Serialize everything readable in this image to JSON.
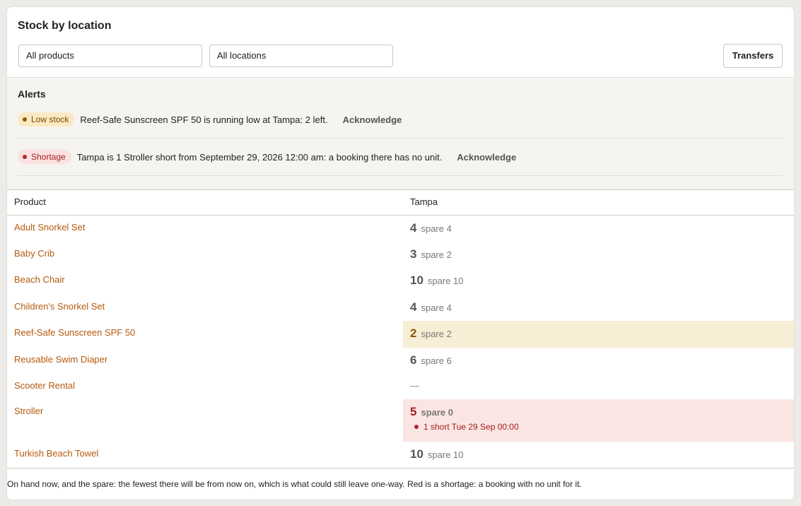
{
  "header": {
    "title": "Stock by location",
    "product_filter": "All products",
    "location_filter": "All locations",
    "transfers_label": "Transfers"
  },
  "alerts": {
    "title": "Alerts",
    "items": [
      {
        "badge": "Low stock",
        "text": "Reef-Safe Sunscreen SPF 50 is running low at Tampa: 2 left.",
        "action": "Acknowledge"
      },
      {
        "badge": "Shortage",
        "text": "Tampa is 1 Stroller short from September 29, 2026 12:00 am: a booking there has no unit.",
        "action": "Acknowledge"
      }
    ]
  },
  "table": {
    "headers": {
      "product": "Product",
      "location": "Tampa"
    },
    "rows": [
      {
        "product": "Adult Snorkel Set",
        "qty": "4",
        "spare": "spare 4"
      },
      {
        "product": "Baby Crib",
        "qty": "3",
        "spare": "spare 2"
      },
      {
        "product": "Beach Chair",
        "qty": "10",
        "spare": "spare 10"
      },
      {
        "product": "Children's Snorkel Set",
        "qty": "4",
        "spare": "spare 4"
      },
      {
        "product": "Reef-Safe Sunscreen SPF 50",
        "qty": "2",
        "spare": "spare 2",
        "status": "low"
      },
      {
        "product": "Reusable Swim Diaper",
        "qty": "6",
        "spare": "spare 6"
      },
      {
        "product": "Scooter Rental",
        "empty": "—"
      },
      {
        "product": "Stroller",
        "qty": "5",
        "spare": "spare 0",
        "status": "short",
        "note": "1 short Tue 29 Sep 00:00"
      },
      {
        "product": "Turkish Beach Towel",
        "qty": "10",
        "spare": "spare 10"
      }
    ]
  },
  "footnote": "On hand now, and the spare: the fewest there will be from now on, which is what could still leave one-way. Red is a shortage: a booking with no unit for it.",
  "colors": {
    "link": "#b5590d",
    "low_bg": "#f8edd5",
    "short_bg": "#fbe5e3",
    "short_text": "#a02020"
  }
}
